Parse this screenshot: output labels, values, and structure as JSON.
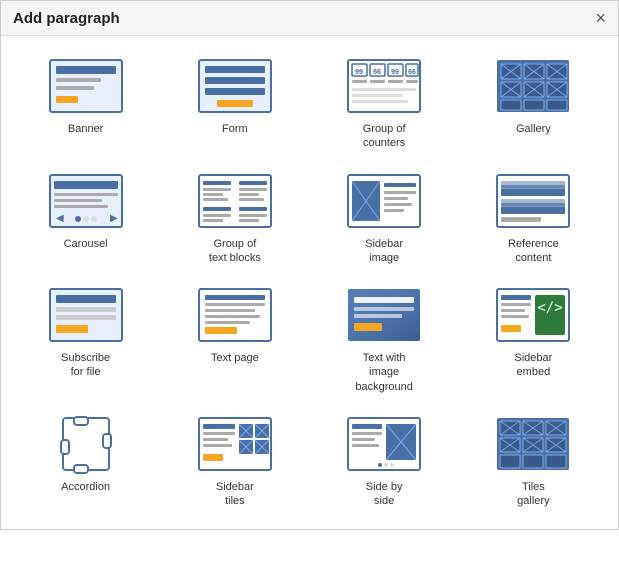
{
  "header": {
    "title": "Add paragraph",
    "close_label": "×"
  },
  "items": [
    {
      "id": "banner",
      "label": "Banner"
    },
    {
      "id": "form",
      "label": "Form"
    },
    {
      "id": "group-of-counters",
      "label": "Group of\ncounters"
    },
    {
      "id": "gallery",
      "label": "Gallery"
    },
    {
      "id": "carousel",
      "label": "Carousel"
    },
    {
      "id": "group-text-blocks",
      "label": "Group of\ntext blocks"
    },
    {
      "id": "sidebar-image",
      "label": "Sidebar\nimage"
    },
    {
      "id": "reference-content",
      "label": "Reference\ncontent"
    },
    {
      "id": "subscribe-for-file",
      "label": "Subscribe\nfor file"
    },
    {
      "id": "text-page",
      "label": "Text page"
    },
    {
      "id": "text-with-image-background",
      "label": "Text with\nimage\nbackground"
    },
    {
      "id": "sidebar-embed",
      "label": "Sidebar\nembed"
    },
    {
      "id": "accordion",
      "label": "Accordion"
    },
    {
      "id": "sidebar-tiles",
      "label": "Sidebar\ntiles"
    },
    {
      "id": "side-by-side",
      "label": "Side by\nside"
    },
    {
      "id": "tiles-gallery",
      "label": "Tiles\ngallery"
    }
  ]
}
